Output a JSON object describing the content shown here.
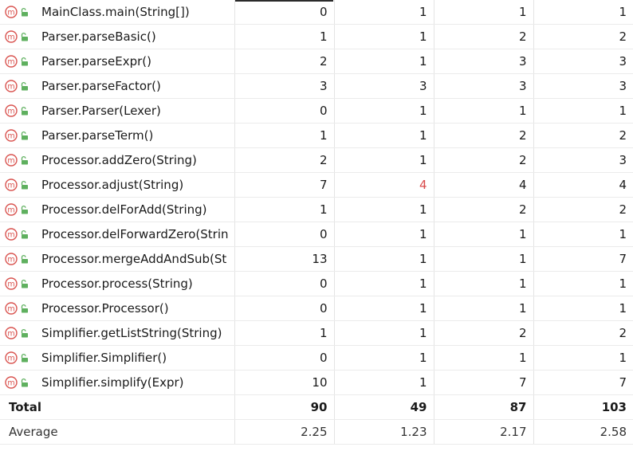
{
  "rows": [
    {
      "name": "MainClass.main(String[])",
      "values": [
        "0",
        "1",
        "1",
        "1"
      ],
      "highlight": [
        false,
        false,
        false,
        false
      ]
    },
    {
      "name": "Parser.parseBasic()",
      "values": [
        "1",
        "1",
        "2",
        "2"
      ],
      "highlight": [
        false,
        false,
        false,
        false
      ]
    },
    {
      "name": "Parser.parseExpr()",
      "values": [
        "2",
        "1",
        "3",
        "3"
      ],
      "highlight": [
        false,
        false,
        false,
        false
      ]
    },
    {
      "name": "Parser.parseFactor()",
      "values": [
        "3",
        "3",
        "3",
        "3"
      ],
      "highlight": [
        false,
        false,
        false,
        false
      ]
    },
    {
      "name": "Parser.Parser(Lexer)",
      "values": [
        "0",
        "1",
        "1",
        "1"
      ],
      "highlight": [
        false,
        false,
        false,
        false
      ]
    },
    {
      "name": "Parser.parseTerm()",
      "values": [
        "1",
        "1",
        "2",
        "2"
      ],
      "highlight": [
        false,
        false,
        false,
        false
      ]
    },
    {
      "name": "Processor.addZero(String)",
      "values": [
        "2",
        "1",
        "2",
        "3"
      ],
      "highlight": [
        false,
        false,
        false,
        false
      ]
    },
    {
      "name": "Processor.adjust(String)",
      "values": [
        "7",
        "4",
        "4",
        "4"
      ],
      "highlight": [
        false,
        true,
        false,
        false
      ]
    },
    {
      "name": "Processor.delForAdd(String)",
      "values": [
        "1",
        "1",
        "2",
        "2"
      ],
      "highlight": [
        false,
        false,
        false,
        false
      ]
    },
    {
      "name": "Processor.delForwardZero(Strin",
      "values": [
        "0",
        "1",
        "1",
        "1"
      ],
      "highlight": [
        false,
        false,
        false,
        false
      ]
    },
    {
      "name": "Processor.mergeAddAndSub(St",
      "values": [
        "13",
        "1",
        "1",
        "7"
      ],
      "highlight": [
        false,
        false,
        false,
        false
      ]
    },
    {
      "name": "Processor.process(String)",
      "values": [
        "0",
        "1",
        "1",
        "1"
      ],
      "highlight": [
        false,
        false,
        false,
        false
      ]
    },
    {
      "name": "Processor.Processor()",
      "values": [
        "0",
        "1",
        "1",
        "1"
      ],
      "highlight": [
        false,
        false,
        false,
        false
      ]
    },
    {
      "name": "Simplifier.getListString(String)",
      "values": [
        "1",
        "1",
        "2",
        "2"
      ],
      "highlight": [
        false,
        false,
        false,
        false
      ]
    },
    {
      "name": "Simplifier.Simplifier()",
      "values": [
        "0",
        "1",
        "1",
        "1"
      ],
      "highlight": [
        false,
        false,
        false,
        false
      ]
    },
    {
      "name": "Simplifier.simplify(Expr)",
      "values": [
        "10",
        "1",
        "7",
        "7"
      ],
      "highlight": [
        false,
        false,
        false,
        false
      ]
    }
  ],
  "total": {
    "label": "Total",
    "values": [
      "90",
      "49",
      "87",
      "103"
    ]
  },
  "average": {
    "label": "Average",
    "values": [
      "2.25",
      "1.23",
      "2.17",
      "2.58"
    ]
  },
  "colors": {
    "method_icon": "#d9534f",
    "lock_icon": "#5fb05f",
    "warning_value": "#d94a4a"
  },
  "icons": {
    "method": "method-icon",
    "visibility": "public-lock-icon"
  }
}
